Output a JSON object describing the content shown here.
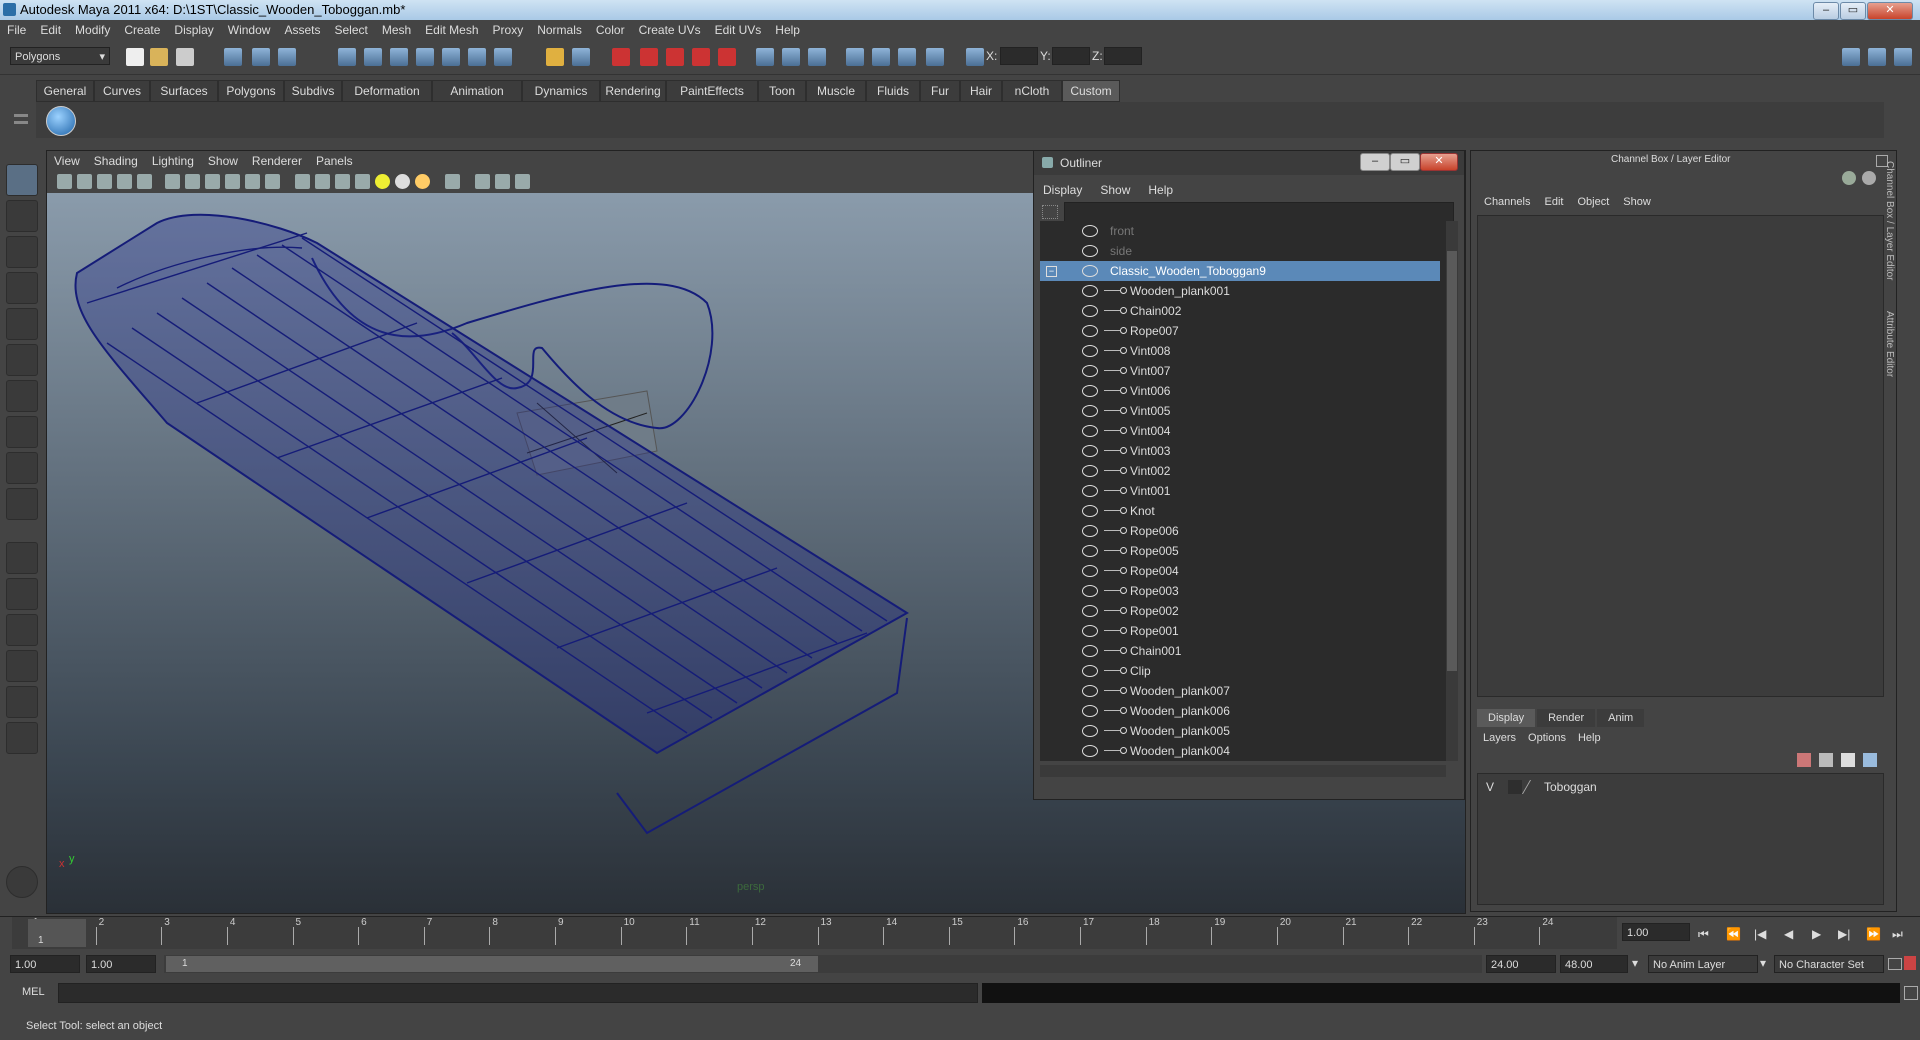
{
  "window": {
    "title": "Autodesk Maya 2011 x64: D:\\1ST\\Classic_Wooden_Toboggan.mb*"
  },
  "menubar": [
    "File",
    "Edit",
    "Modify",
    "Create",
    "Display",
    "Window",
    "Assets",
    "Select",
    "Mesh",
    "Edit Mesh",
    "Proxy",
    "Normals",
    "Color",
    "Create UVs",
    "Edit UVs",
    "Help"
  ],
  "statusline": {
    "mode": "Polygons",
    "x_label": "X:",
    "y_label": "Y:",
    "z_label": "Z:"
  },
  "shelf_tabs": [
    "General",
    "Curves",
    "Surfaces",
    "Polygons",
    "Subdivs",
    "Deformation",
    "Animation",
    "Dynamics",
    "Rendering",
    "PaintEffects",
    "Toon",
    "Muscle",
    "Fluids",
    "Fur",
    "Hair",
    "nCloth",
    "Custom"
  ],
  "viewport": {
    "menus": [
      "View",
      "Shading",
      "Lighting",
      "Show",
      "Renderer",
      "Panels"
    ],
    "camera": "persp",
    "axis_x": "x",
    "axis_y": "y"
  },
  "outliner": {
    "title": "Outliner",
    "menus": [
      "Display",
      "Show",
      "Help"
    ],
    "items": [
      {
        "label": "front",
        "dim": true,
        "child": false
      },
      {
        "label": "side",
        "dim": true,
        "child": false
      },
      {
        "label": "Classic_Wooden_Toboggan9",
        "selected": true,
        "child": false
      },
      {
        "label": "Wooden_plank001",
        "child": true
      },
      {
        "label": "Chain002",
        "child": true
      },
      {
        "label": "Rope007",
        "child": true
      },
      {
        "label": "Vint008",
        "child": true
      },
      {
        "label": "Vint007",
        "child": true
      },
      {
        "label": "Vint006",
        "child": true
      },
      {
        "label": "Vint005",
        "child": true
      },
      {
        "label": "Vint004",
        "child": true
      },
      {
        "label": "Vint003",
        "child": true
      },
      {
        "label": "Vint002",
        "child": true
      },
      {
        "label": "Vint001",
        "child": true
      },
      {
        "label": "Knot",
        "child": true
      },
      {
        "label": "Rope006",
        "child": true
      },
      {
        "label": "Rope005",
        "child": true
      },
      {
        "label": "Rope004",
        "child": true
      },
      {
        "label": "Rope003",
        "child": true
      },
      {
        "label": "Rope002",
        "child": true
      },
      {
        "label": "Rope001",
        "child": true
      },
      {
        "label": "Chain001",
        "child": true
      },
      {
        "label": "Clip",
        "child": true
      },
      {
        "label": "Wooden_plank007",
        "child": true
      },
      {
        "label": "Wooden_plank006",
        "child": true
      },
      {
        "label": "Wooden_plank005",
        "child": true
      },
      {
        "label": "Wooden_plank004",
        "child": true
      }
    ]
  },
  "channel_box": {
    "title": "Channel Box / Layer Editor",
    "menus": [
      "Channels",
      "Edit",
      "Object",
      "Show"
    ],
    "side_tab_channel": "Channel Box / Layer Editor",
    "side_tab_attr": "Attribute Editor",
    "layer_tabs": [
      "Display",
      "Render",
      "Anim"
    ],
    "layer_menus": [
      "Layers",
      "Options",
      "Help"
    ],
    "layer": {
      "visible": "V",
      "name": "Toboggan"
    }
  },
  "timeline": {
    "ticks": [
      "1",
      "2",
      "3",
      "4",
      "5",
      "6",
      "7",
      "8",
      "9",
      "10",
      "11",
      "12",
      "13",
      "14",
      "15",
      "16",
      "17",
      "18",
      "19",
      "20",
      "21",
      "22",
      "23",
      "24"
    ],
    "current_frame": "1.00",
    "cursor_label": "1"
  },
  "range": {
    "start": "1.00",
    "start_inner": "1.00",
    "slider_start": "1",
    "slider_end": "24",
    "end_inner": "24.00",
    "end": "48.00",
    "anim_layer": "No Anim Layer",
    "char_set": "No Character Set"
  },
  "cmd": {
    "label": "MEL"
  },
  "help": {
    "text": "Select Tool: select an object"
  }
}
